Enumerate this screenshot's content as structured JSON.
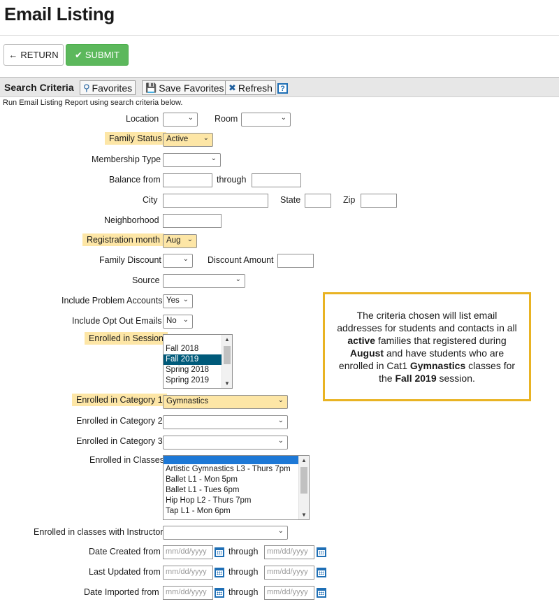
{
  "page": {
    "title": "Email Listing",
    "return_label": "RETURN",
    "submit_label": "SUBMIT"
  },
  "search": {
    "section_title": "Search Criteria",
    "favorites_label": "Favorites",
    "save_favorites_label": "Save Favorites",
    "refresh_label": "Refresh",
    "description": "Run Email Listing Report using search criteria below."
  },
  "fields": {
    "location": "Location",
    "room": "Room",
    "family_status": "Family Status",
    "family_status_value": "Active",
    "membership_type": "Membership Type",
    "balance_from": "Balance from",
    "through": "through",
    "city": "City",
    "state": "State",
    "zip": "Zip",
    "neighborhood": "Neighborhood",
    "registration_month": "Registration month",
    "registration_month_value": "Aug",
    "family_discount": "Family Discount",
    "discount_amount": "Discount Amount",
    "source": "Source",
    "include_problem_accounts": "Include Problem Accounts",
    "include_problem_accounts_value": "Yes",
    "include_opt_out_emails": "Include Opt Out Emails",
    "include_opt_out_emails_value": "No",
    "enrolled_in_session": "Enrolled in Session",
    "sessions": [
      "Fall 2018",
      "Fall 2019",
      "Spring 2018",
      "Spring 2019"
    ],
    "enrolled_cat1": "Enrolled in Category 1",
    "enrolled_cat1_value": "Gymnastics",
    "enrolled_cat2": "Enrolled in Category 2",
    "enrolled_cat3": "Enrolled in Category 3",
    "enrolled_classes": "Enrolled in Classes",
    "classes": [
      "",
      "Artistic Gymnastics L3 - Thurs 7pm",
      "Ballet L1 - Mon 5pm",
      "Ballet L1 - Tues 6pm",
      "Hip Hop L2 - Thurs 7pm",
      "Tap L1 - Mon 6pm"
    ],
    "enrolled_instructor": "Enrolled in classes with Instructor",
    "date_created_from": "Date Created from",
    "last_updated_from": "Last Updated from",
    "date_imported_from": "Date Imported from",
    "date_placeholder": "mm/dd/yyyy"
  },
  "callout": {
    "line_a": "The criteria chosen will list email addresses for students and contacts in all ",
    "bold_active": "active",
    "line_b": " families that registered during ",
    "bold_august": "August",
    "line_c": " and have students who are enrolled in Cat1 ",
    "bold_gymnastics": "Gymnastics",
    "line_d": " classes for the ",
    "bold_fall": "Fall 2019",
    "line_e": " session."
  },
  "colors": {
    "submit_green": "#5cb85c",
    "highlight": "#fde6a6",
    "callout_border": "#e9b323",
    "selected_option": "#005a7a"
  }
}
